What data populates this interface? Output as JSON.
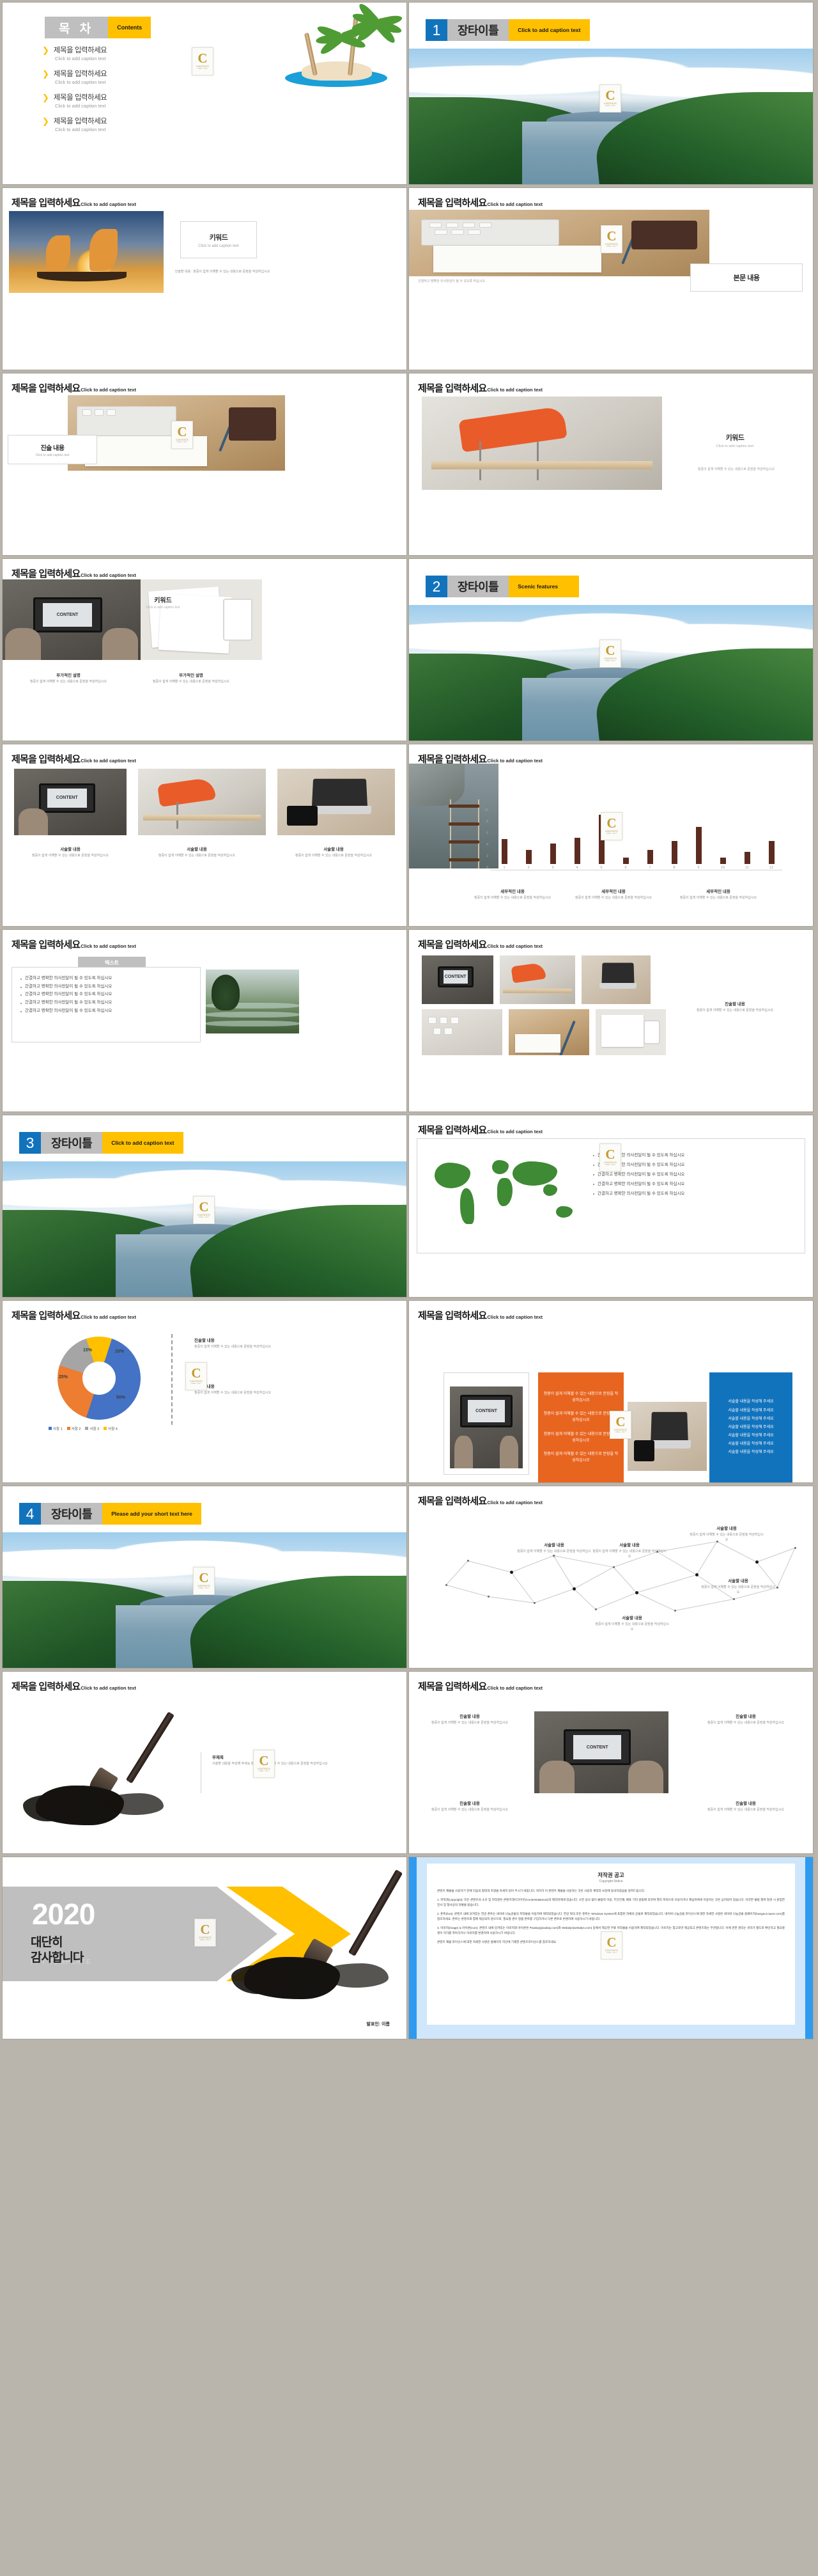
{
  "deck": {
    "logo": {
      "letter": "C",
      "name": "CONTENTS",
      "sub": "TAKE / OUT"
    },
    "colors": {
      "accent_yellow": "#ffc000",
      "accent_blue": "#1273bd",
      "gray": "#bfbfbf",
      "orange": "#e8651f",
      "bar": "#5c2b20"
    },
    "common": {
      "title_ko": "제목을 입력하세요",
      "title_caption": "Click to add caption text",
      "chapter_title": "장타이틀",
      "caption_hint": "Click to add caption text",
      "body_sentence": "간결하고 명확한 의사전달이 될 수 있도록 하십시오",
      "detail_head": "세부적인 내용",
      "detail_body": "청중이 쉽게 이해할 수 있는 내용으로 문장을 작성하십시오",
      "describe_head": "서술할 내용",
      "describe_body": "청중이 쉽게 이해할 수 있는 내용으로 문장을 작성하십시오",
      "describe_line": "서술할 내용을 작성해 주세요",
      "panel_orange_line": "청중이 쉽게 이해할 수 있는 내용으로 문장을 작성하십시오"
    }
  },
  "slide1": {
    "badge_ko": "목 차",
    "badge_en": "Contents",
    "items": [
      {
        "title": "제목을 입력하세요",
        "caption": "Click to add caption text"
      },
      {
        "title": "제목을 입력하세요",
        "caption": "Click to add caption text"
      },
      {
        "title": "제목을 입력하세요",
        "caption": "Click to add caption text"
      },
      {
        "title": "제목을 입력하세요",
        "caption": "Click to add caption text"
      }
    ]
  },
  "slide2": {
    "number": "1",
    "title": "장타이틀",
    "caption": "Click to add caption text"
  },
  "slide3": {
    "title": "제목을 입력하세요",
    "caption": "Click to add caption text",
    "keyword": "키워드",
    "keyword_caption": "Click to add caption text",
    "body": "진술할 내용 : 청중이 쉽게 이해할 수 있는 내용으로 문장을 작성하십시오"
  },
  "slide4": {
    "title": "제목을 입력하세요",
    "caption": "Click to add caption text",
    "footer": "간결하고 명확한 의사전달이 될 수 있도록 하십시오",
    "box_label": "본문 내용"
  },
  "slide5": {
    "title": "제목을 입력하세요",
    "caption": "Click to add caption text",
    "box_title": "진술 내용",
    "box_caption": "Click to add caption text"
  },
  "slide6": {
    "title": "제목을 입력하세요",
    "caption": "Click to add caption text",
    "keyword": "키워드",
    "keyword_caption": "Click to add caption text",
    "body": "청중이 쉽게 이해할 수 있는 내용으로 문장을 작성하십시오"
  },
  "slide7": {
    "title": "제목을 입력하세요",
    "caption": "Click to add caption text",
    "keyword": "키워드",
    "keyword_caption": "Click to add caption text",
    "cols": [
      {
        "head": "부가적인 설명",
        "body": "청중이 쉽게 이해할 수 있는 내용으로 문장을 작성하십시오"
      },
      {
        "head": "부가적인 설명",
        "body": "청중이 쉽게 이해할 수 있는 내용으로 문장을 작성하십시오"
      }
    ]
  },
  "slide8": {
    "number": "2",
    "title": "장타이틀",
    "caption": "Scenic features"
  },
  "slide9": {
    "title": "제목을 입력하세요",
    "caption": "Click to add caption text",
    "cols": [
      {
        "head": "서술할 내용",
        "body": "청중이 쉽게 이해할 수 있는 내용으로 문장을 작성하십시오"
      },
      {
        "head": "서술할 내용",
        "body": "청중이 쉽게 이해할 수 있는 내용으로 문장을 작성하십시오"
      },
      {
        "head": "서술할 내용",
        "body": "청중이 쉽게 이해할 수 있는 내용으로 문장을 작성하십시오"
      }
    ]
  },
  "slide10": {
    "title": "제목을 입력하세요",
    "caption": "Click to add caption text",
    "cols": [
      {
        "head": "세부적인 내용",
        "body": "청중이 쉽게 이해할 수 있는 내용으로 문장을 작성하십시오"
      },
      {
        "head": "세부적인 내용",
        "body": "청중이 쉽게 이해할 수 있는 내용으로 문장을 작성하십시오"
      },
      {
        "head": "세부적인 내용",
        "body": "청중이 쉽게 이해할 수 있는 내용으로 문장을 작성하십시오"
      }
    ],
    "chart_data": {
      "type": "bar",
      "title": "",
      "categories": [
        "1",
        "2",
        "3",
        "4",
        "5",
        "6",
        "7",
        "8",
        "9",
        "10",
        "11",
        "12"
      ],
      "values": [
        4.1,
        2.3,
        3.3,
        4.3,
        8.0,
        1.0,
        2.3,
        3.8,
        6.0,
        1.0,
        2.0,
        3.8
      ],
      "ylabel": "",
      "xlabel": "",
      "yticks": [
        "0",
        "2",
        "4",
        "6",
        "8",
        "10"
      ],
      "ylim": [
        0,
        10
      ],
      "grid": false,
      "legend": "none",
      "series_color": "#5c2b20"
    }
  },
  "slide11": {
    "title": "제목을 입력하세요",
    "caption": "Click to add caption text",
    "badge": "텍스트",
    "bullets": [
      "간결하고 명확한 의사전달이 될 수 있도록 하십시오",
      "간결하고 명확한 의사전달이 될 수 있도록 하십시오",
      "간결하고 명확한 의사전달이 될 수 있도록 하십시오",
      "간결하고 명확한 의사전달이 될 수 있도록 하십시오",
      "간결하고 명확한 의사전달이 될 수 있도록 하십시오"
    ]
  },
  "slide12": {
    "title": "제목을 입력하세요",
    "caption": "Click to add caption text",
    "side_head": "진술할 내용",
    "side_body": "청중이 쉽게 이해할 수 있는 내용으로 문장을 작성하십시오"
  },
  "slide13": {
    "number": "3",
    "title": "장타이틀",
    "caption": "Click to add caption text"
  },
  "slide14": {
    "title": "제목을 입력하세요",
    "caption": "Click to add caption text",
    "bullets": [
      "간결하고 명확한 의사전달이 될 수 있도록 하십시오",
      "간결하고 명확한 의사전달이 될 수 있도록 하십시오",
      "간결하고 명확한 의사전달이 될 수 있도록 하십시오",
      "간결하고 명확한 의사전달이 될 수 있도록 하십시오",
      "간결하고 명확한 의사전달이 될 수 있도록 하십시오"
    ]
  },
  "slide15": {
    "title": "제목을 입력하세요",
    "caption": "Click to add caption text",
    "right_blocks": [
      {
        "head": "진술할 내용",
        "body": "청중이 쉽게 이해할 수 있는 내용으로 문장을 작성하십시오"
      },
      {
        "head": "진술할 내용",
        "body": "청중이 쉽게 이해할 수 있는 내용으로 문장을 작성하십시오"
      }
    ],
    "chart_data": {
      "type": "pie",
      "title": "",
      "labels": [
        "사항 1",
        "사항 2",
        "사항 3",
        "사항 4"
      ],
      "values": [
        50,
        25,
        15,
        10
      ],
      "display_labels": [
        "50%",
        "25%",
        "15%",
        "10%"
      ],
      "colors": [
        "#4472c4",
        "#ed7d31",
        "#a5a5a5",
        "#ffc000"
      ],
      "legend": "bottom",
      "donut": true
    }
  },
  "slide16": {
    "title": "제목을 입력하세요",
    "caption": "Click to add caption text",
    "orange_lines": [
      "청중이 쉽게 이해할 수 있는 내용으로 문장을 작성하십시오",
      "청중이 쉽게 이해할 수 있는 내용으로 문장을 작성하십시오",
      "청중이 쉽게 이해할 수 있는 내용으로 문장을 작성하십시오",
      "청중이 쉽게 이해할 수 있는 내용으로 문장을 작성하십시오"
    ],
    "blue_lines": [
      "서술할 내용을 작성해 주세요",
      "서술할 내용을 작성해 주세요",
      "서술할 내용을 작성해 주세요",
      "서술할 내용을 작성해 주세요",
      "서술할 내용을 작성해 주세요",
      "서술할 내용을 작성해 주세요",
      "서술할 내용을 작성해 주세요"
    ]
  },
  "slide17": {
    "number": "4",
    "title": "장타이틀",
    "caption": "Please add your short text here"
  },
  "slide18": {
    "title": "제목을 입력하세요",
    "caption": "Click to add caption text",
    "nodes": [
      {
        "head": "서술할 내용",
        "body": "청중이 쉽게 이해할 수 있는 내용으로 문장을 작성하십시오"
      },
      {
        "head": "서술할 내용",
        "body": "청중이 쉽게 이해할 수 있는 내용으로 문장을 작성하십시오"
      },
      {
        "head": "서술할 내용",
        "body": "청중이 쉽게 이해할 수 있는 내용으로 문장을 작성하십시오"
      },
      {
        "head": "서술할 내용",
        "body": "청중이 쉽게 이해할 수 있는 내용으로 문장을 작성하십시오"
      },
      {
        "head": "서술할 내용",
        "body": "청중이 쉽게 이해할 수 있는 내용으로 문장을 작성하십시오"
      }
    ]
  },
  "slide19": {
    "title": "제목을 입력하세요",
    "caption": "Click to add caption text",
    "head": "부제목",
    "body": "서술할 내용을 작성해 주세요 청중이 쉽게 이해할 수 있는 내용으로 문장을 작성하십시오"
  },
  "slide20": {
    "title": "제목을 입력하세요",
    "caption": "Click to add caption text",
    "blocks": [
      {
        "head": "진술할 내용",
        "body": "청중이 쉽게 이해할 수 있는 내용으로 문장을 작성하십시오"
      },
      {
        "head": "진술할 내용",
        "body": "청중이 쉽게 이해할 수 있는 내용으로 문장을 작성하십시오"
      },
      {
        "head": "진술할 내용",
        "body": "청중이 쉽게 이해할 수 있는 내용으로 문장을 작성하십시오"
      },
      {
        "head": "진술할 내용",
        "body": "청중이 쉽게 이해할 수 있는 내용으로 문장을 작성하십시오"
      }
    ]
  },
  "slide21": {
    "year": "2020",
    "thanks": "대단히\n감사합니다",
    "template_label": "PPT TEMPLATE",
    "presenter": "발표인: 이름"
  },
  "slide22": {
    "title": "저작권 공고",
    "subtitle": "Copyright Notice",
    "paragraphs": [
      "콘텐츠 제물을 사용하기 전에 다음의 협약과 조항을 자세히 읽어 주시기 바랍니다. 귀하가 이 콘텐츠 제물을 사용하는 것은 사용자 계약과 보증에 동의하셨음을 알려드립니다.",
      "1. 저작권(copyright): 모든 콘텐츠의 소유 및 저작권은 콘텐츠테이크아웃(Contentstakeout)과 제작자에게 있습니다. 사전 승낙 없이 불법적 이용, 무단전재, 배포 기타 방법에 의하여 영리 목적으로 이용하거나 제삼자에게 이용하는 것은 금지되어 있습니다. 이러한 불법 행위 발견 시 준엄한 민사 및 형사상의 처벌을 받습니다.",
      "2. 폰트(font): 콘텐츠 내에 담겨있는 한글 폰트는 네이버 나눔글꼴의 저작물을 이용하여 제작되었습니다. 한글 외의 모든 폰트는 Windows System에 포함된 자체의 글꼴로 제작되었습니다. 네이버 나눔글꼴 라이선스에 대한 자세한 사항은 네이버 나눔글꼴 홈페이지(hangeul.naver.com)를 참조하세요. 폰트는 콘텐츠와 함께 제공되지 않으므로, 필요할 경우 정품 폰트를 구입하거나 다른 폰트로 변경하여 사용하시기 바랍니다.",
      "3. 이미지(image) & 아이콘(icon): 콘텐츠 내에 담겨있는 이미지와 아이콘은 Pixabay(pixabay.com)와 Webalys(webalys.com) 등에서 제공한 무료 저작물을 이용하여 제작되었습니다. 이미지는 참고로만 제공되고 콘텐츠와는 무관합니다. 이에 관한 권리는 귀하가 별도로 확인하고 필요할 경우 허가를 취득하거나 이미지를 변경하여 사용하시기 바랍니다.",
      "콘텐츠 제물 라이선스에 대한 자세한 사항은 홈페이지 하단에 기재한 콘텐츠라이선스를 참조하세요."
    ]
  }
}
